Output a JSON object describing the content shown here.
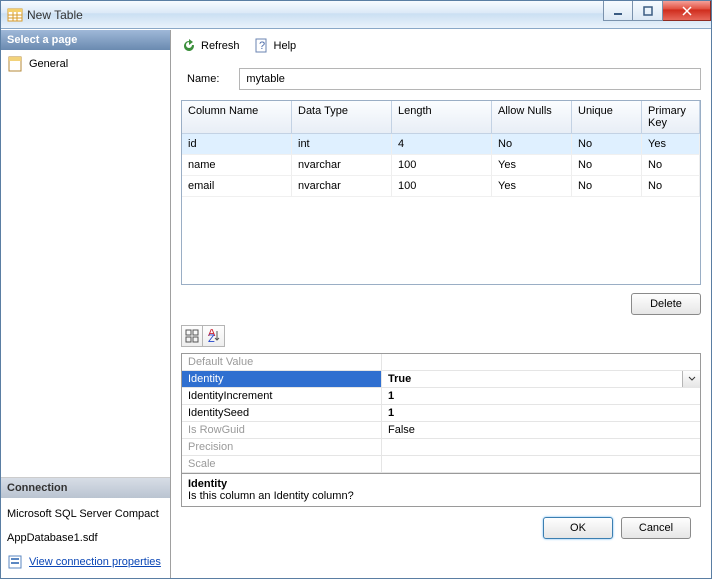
{
  "window": {
    "title": "New Table"
  },
  "sidebar": {
    "pages_header": "Select a page",
    "pages": [
      {
        "label": "General"
      }
    ],
    "connection_header": "Connection"
  },
  "connection": {
    "server": "Microsoft SQL Server Compact",
    "database": "AppDatabase1.sdf",
    "link_label": "View connection properties"
  },
  "toolbar": {
    "refresh": "Refresh",
    "help": "Help"
  },
  "form": {
    "name_label": "Name:",
    "name_value": "mytable"
  },
  "columns": {
    "headers": [
      "Column Name",
      "Data Type",
      "Length",
      "Allow Nulls",
      "Unique",
      "Primary Key"
    ],
    "rows": [
      {
        "name": "id",
        "type": "int",
        "length": "4",
        "nulls": "No",
        "unique": "No",
        "pk": "Yes"
      },
      {
        "name": "name",
        "type": "nvarchar",
        "length": "100",
        "nulls": "Yes",
        "unique": "No",
        "pk": "No"
      },
      {
        "name": "email",
        "type": "nvarchar",
        "length": "100",
        "nulls": "Yes",
        "unique": "No",
        "pk": "No"
      }
    ]
  },
  "props": [
    {
      "k": "Default Value",
      "v": ""
    },
    {
      "k": "Identity",
      "v": "True"
    },
    {
      "k": "IdentityIncrement",
      "v": "1"
    },
    {
      "k": "IdentitySeed",
      "v": "1"
    },
    {
      "k": "Is RowGuid",
      "v": "False"
    },
    {
      "k": "Precision",
      "v": ""
    },
    {
      "k": "Scale",
      "v": ""
    }
  ],
  "description": {
    "title": "Identity",
    "text": "Is this column an Identity column?"
  },
  "buttons": {
    "delete": "Delete",
    "ok": "OK",
    "cancel": "Cancel"
  }
}
